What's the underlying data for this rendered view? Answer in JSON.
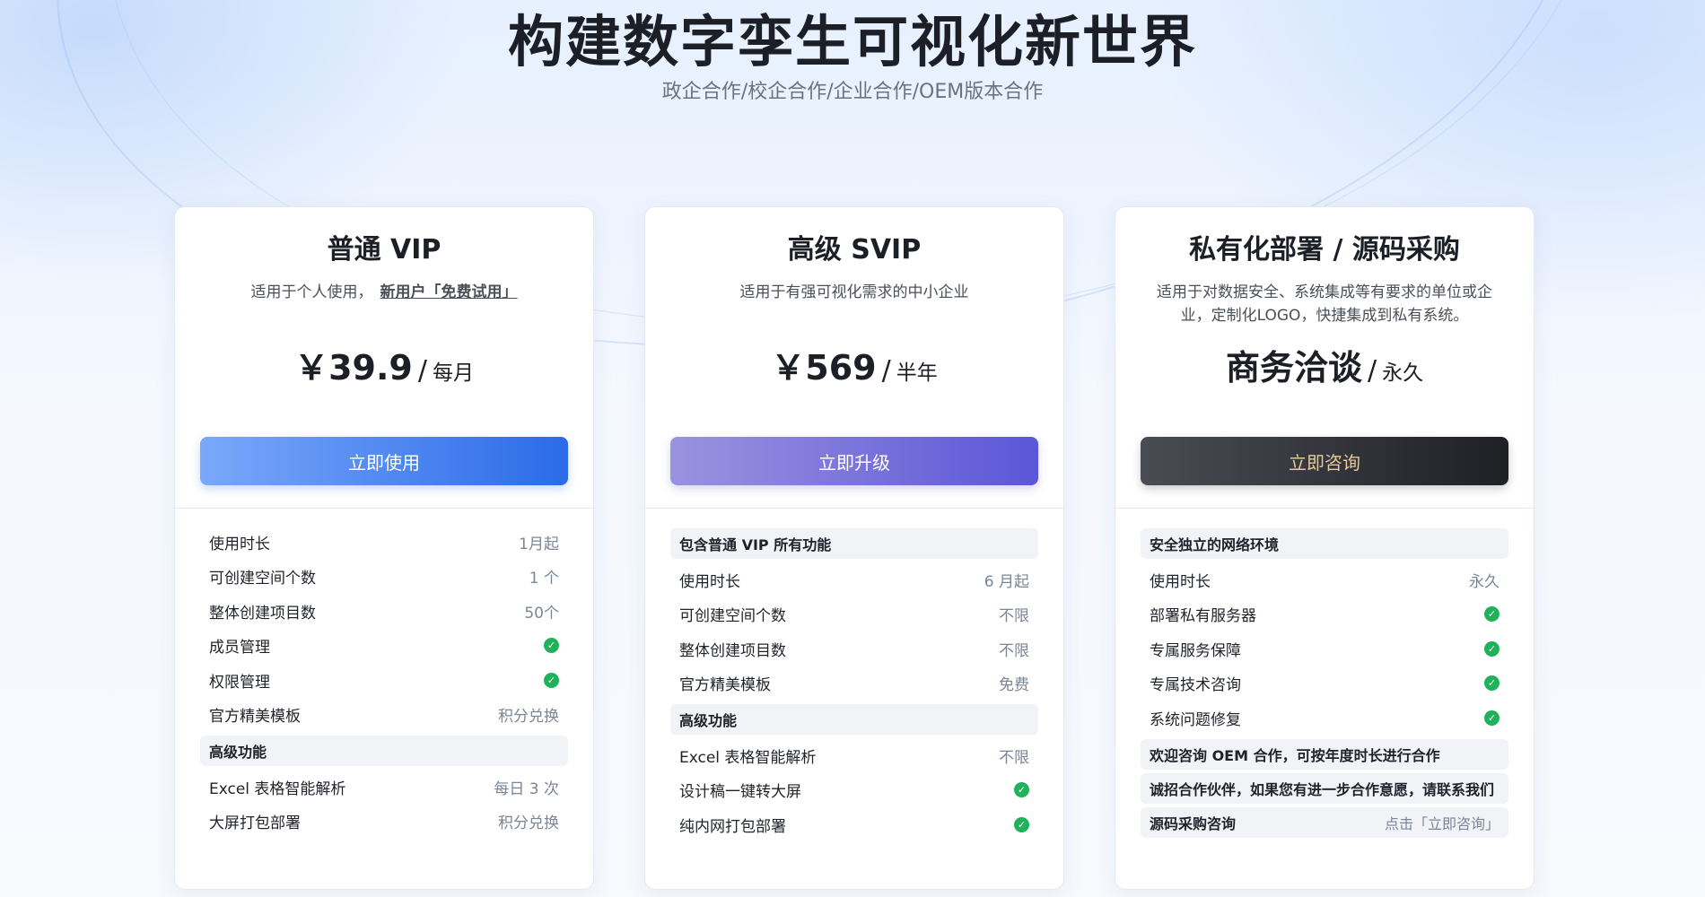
{
  "hero": {
    "title": "构建数字孪生可视化新世界",
    "subtitle": "政企合作/校企合作/企业合作/OEM版本合作"
  },
  "plans": [
    {
      "title": "普通 VIP",
      "desc": "适用于个人使用，",
      "trial": "新用户「免费试用」",
      "price": "￥39.9",
      "slash": "/",
      "unit": "每月",
      "cta": "立即使用",
      "features": [
        {
          "label": "使用时长",
          "value": "1月起"
        },
        {
          "label": "可创建空间个数",
          "value": "1 个"
        },
        {
          "label": "整体创建项目数",
          "value": "50个"
        },
        {
          "label": "成员管理",
          "check": true
        },
        {
          "label": "权限管理",
          "check": true
        },
        {
          "label": "官方精美模板",
          "value": "积分兑换"
        },
        {
          "section": "高级功能"
        },
        {
          "label": "Excel 表格智能解析",
          "value": "每日 3 次"
        },
        {
          "label": "大屏打包部署",
          "value": "积分兑换"
        }
      ]
    },
    {
      "title": "高级 SVIP",
      "desc": "适用于有强可视化需求的中小企业",
      "price": "￥569",
      "slash": "/",
      "unit": "半年",
      "cta": "立即升级",
      "features": [
        {
          "section": "包含普通 VIP 所有功能"
        },
        {
          "label": "使用时长",
          "value": "6 月起"
        },
        {
          "label": "可创建空间个数",
          "value": "不限"
        },
        {
          "label": "整体创建项目数",
          "value": "不限"
        },
        {
          "label": "官方精美模板",
          "value": "免费"
        },
        {
          "section": "高级功能"
        },
        {
          "label": "Excel 表格智能解析",
          "value": "不限"
        },
        {
          "label": "设计稿一键转大屏",
          "check": true
        },
        {
          "label": "纯内网打包部署",
          "check": true
        }
      ]
    },
    {
      "title": "私有化部署 / 源码采购",
      "desc": "适用于对数据安全、系统集成等有要求的单位或企业，定制化LOGO，快捷集成到私有系统。",
      "price": "商务洽谈",
      "slash": "/",
      "unit": "永久",
      "cta": "立即咨询",
      "features": [
        {
          "section": "安全独立的网络环境"
        },
        {
          "label": "使用时长",
          "value": "永久"
        },
        {
          "label": "部署私有服务器",
          "check": true
        },
        {
          "label": "专属服务保障",
          "check": true
        },
        {
          "label": "专属技术咨询",
          "check": true
        },
        {
          "label": "系统问题修复",
          "check": true
        },
        {
          "section": "欢迎咨询 OEM 合作，可按年度时长进行合作"
        },
        {
          "section": "诚招合作伙伴，如果您有进一步合作意愿，请联系我们"
        },
        {
          "section": "源码采购咨询",
          "value": "点击「立即咨询」"
        }
      ]
    }
  ],
  "icons": {
    "check": "check-circle-icon"
  },
  "colors": {
    "vip_cta": "#2b6be8",
    "svip_cta": "#5b56d8",
    "private_cta": "#1f2024",
    "private_cta_text": "#e7c99a",
    "check": "#1fb25a"
  }
}
